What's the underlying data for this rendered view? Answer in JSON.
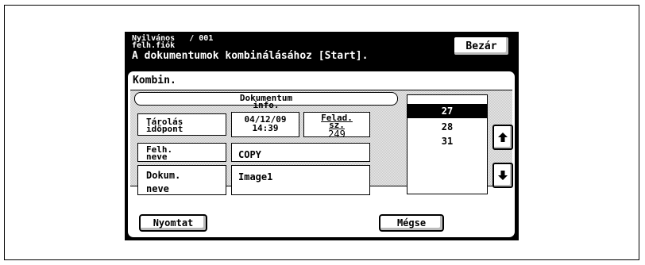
{
  "header": {
    "account_line1": "Nyilvános   / 001",
    "account_line2": "felh.fiók",
    "instruction": "A dokumentumok kombinálásához [Start].",
    "close_label": "Bezár"
  },
  "panel": {
    "title": "Kombin.",
    "doc_info_label": "Dokumentum info.",
    "stored_time_label": "Tárolás időpont",
    "stored_date": "04/12/09",
    "stored_time": "14:39",
    "job_number_label": "Felad. sz.",
    "job_number": "249",
    "user_name_label": "Felh. neve",
    "user_name": "COPY",
    "doc_name_label": "Dokum. neve",
    "doc_name": "Image1"
  },
  "job_list": {
    "items": [
      "27",
      "28",
      "31"
    ],
    "selected": "27"
  },
  "footer": {
    "print_label": "Nyomtat",
    "cancel_label": "Mégse"
  }
}
